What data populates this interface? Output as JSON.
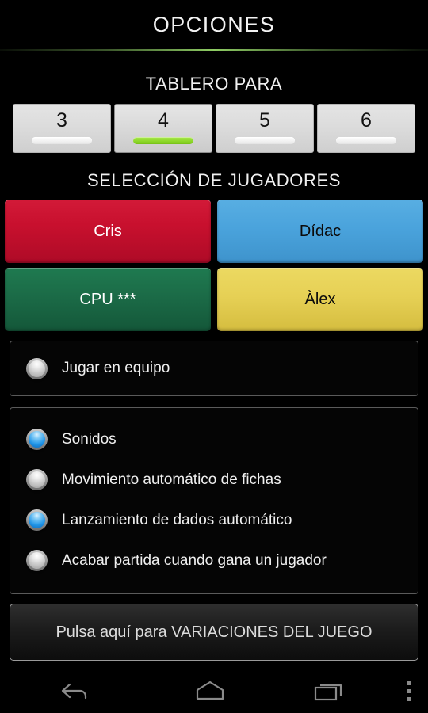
{
  "header": {
    "title": "OPCIONES"
  },
  "board": {
    "heading": "TABLERO PARA",
    "options": [
      {
        "label": "3",
        "selected": false
      },
      {
        "label": "4",
        "selected": true
      },
      {
        "label": "5",
        "selected": false
      },
      {
        "label": "6",
        "selected": false
      }
    ],
    "selected_value": "4",
    "selected_indicator_color": "#8fd92c",
    "unselected_indicator_color": "#ffffff"
  },
  "players": {
    "heading": "SELECCIÓN DE JUGADORES",
    "items": [
      {
        "name": "Cris",
        "color": "#c8102e",
        "text_color": "#ffffff"
      },
      {
        "name": "Dídac",
        "color": "#4aa3dc",
        "text_color": "#0b0b0b"
      },
      {
        "name": "CPU ***",
        "color": "#1b6b47",
        "text_color": "#ffffff"
      },
      {
        "name": "Àlex",
        "color": "#e6d055",
        "text_color": "#0b0b0b"
      }
    ]
  },
  "team_panel": {
    "options": [
      {
        "label": "Jugar en equipo",
        "checked": false
      }
    ]
  },
  "settings_panel": {
    "options": [
      {
        "label": "Sonidos",
        "checked": true
      },
      {
        "label": "Movimiento automático de fichas",
        "checked": false
      },
      {
        "label": "Lanzamiento de dados automático",
        "checked": true
      },
      {
        "label": "Acabar partida cuando gana un jugador",
        "checked": false
      }
    ]
  },
  "variations": {
    "label": "Pulsa aquí para VARIACIONES DEL JUEGO"
  },
  "navbar": {
    "back_icon": "back-arrow-icon",
    "home_icon": "home-pentagon-icon",
    "recents_icon": "recents-icon",
    "menu_icon": "overflow-menu-icon"
  }
}
